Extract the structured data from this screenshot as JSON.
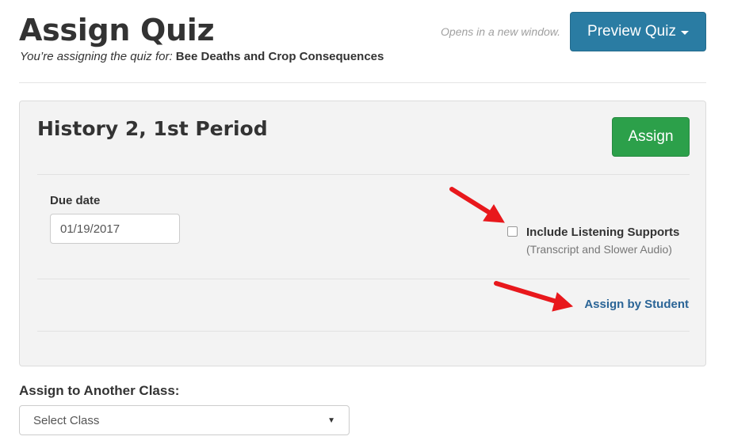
{
  "header": {
    "title": "Assign Quiz",
    "subtitle_prefix": "You’re assigning the quiz for:",
    "quiz_name": "Bee Deaths and Crop Consequences",
    "opens_note": "Opens in a new window.",
    "preview_button_label": "Preview Quiz"
  },
  "class_panel": {
    "class_name": "History 2, 1st Period",
    "assign_button_label": "Assign",
    "due_date_label": "Due date",
    "due_date_value": "01/19/2017",
    "listening_supports_label": "Include Listening Supports",
    "listening_supports_sublabel": "(Transcript and Slower Audio)",
    "listening_supports_checked": false,
    "assign_by_student_label": "Assign by Student"
  },
  "another_class": {
    "label": "Assign to Another Class:",
    "select_value": "Select Class"
  },
  "colors": {
    "preview_button": "#2a7ca3",
    "assign_button": "#2ca04a",
    "link": "#2a6496",
    "annotation_arrow": "#e8181c"
  }
}
